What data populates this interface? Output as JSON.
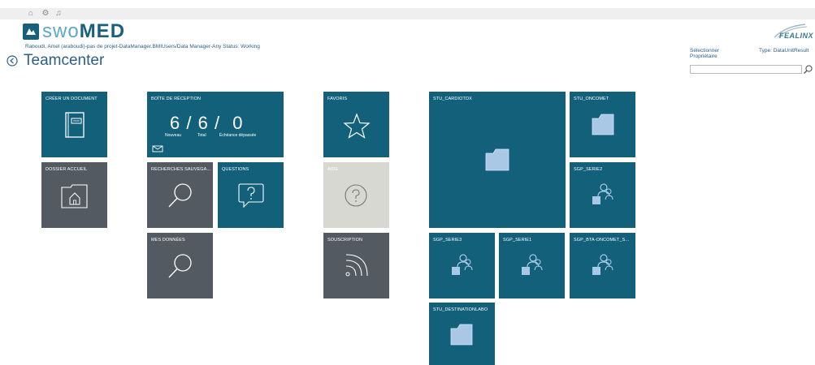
{
  "header": {
    "logo_text_a": "swo",
    "logo_text_b": "MED",
    "user_line": "Raboudi, Amel (araboudi)-pas de projet-DataManager.BMIUsers/Data Manager-Any Status: Working",
    "app_title": "Teamcenter",
    "brand": "FEALINX",
    "select_owner": "Sélectionner Propriétaire",
    "type_label": "Type: DataUnitResult",
    "search_value": "",
    "colors": {
      "brand_blue": "#12607a",
      "tile_gray": "#545a62",
      "tile_light": "#d8d8d2",
      "folder_fill": "#a9c8e6"
    }
  },
  "tiles": {
    "create_doc": "CRÉER UN DOCUMENT",
    "inbox": "BOÎTE DE RÉCEPTION",
    "inbox_new": "6",
    "inbox_total": "6",
    "inbox_overdue": "0",
    "inbox_sep1": "/",
    "inbox_sep2": "/",
    "inbox_new_lbl": "Nouveau",
    "inbox_total_lbl": "Total",
    "inbox_overdue_lbl": "Échéance dépassée",
    "favorites": "FAVORIS",
    "home_folder": "DOSSIER ACCUEIL",
    "saved_searches": "RECHERCHES SAUVEGA...",
    "questions": "QUESTIONS",
    "help": "AIDE",
    "my_data": "MES DONNÉES",
    "subscription": "SOUSCRIPTION",
    "stu_cardiotox": "STU_CARDIOTOX",
    "stu_oncomet": "STU_ONCOMET",
    "sgp_serie2": "SGP_SERIE2",
    "sgp_serie3": "SGP_SERIE3",
    "sgp_serie1": "SGP_SERIE1",
    "sgp_bta": "SGP_BTA-ONCOMET_S...",
    "stu_destinationlabo": "STU_DESTINATIONLABO"
  }
}
